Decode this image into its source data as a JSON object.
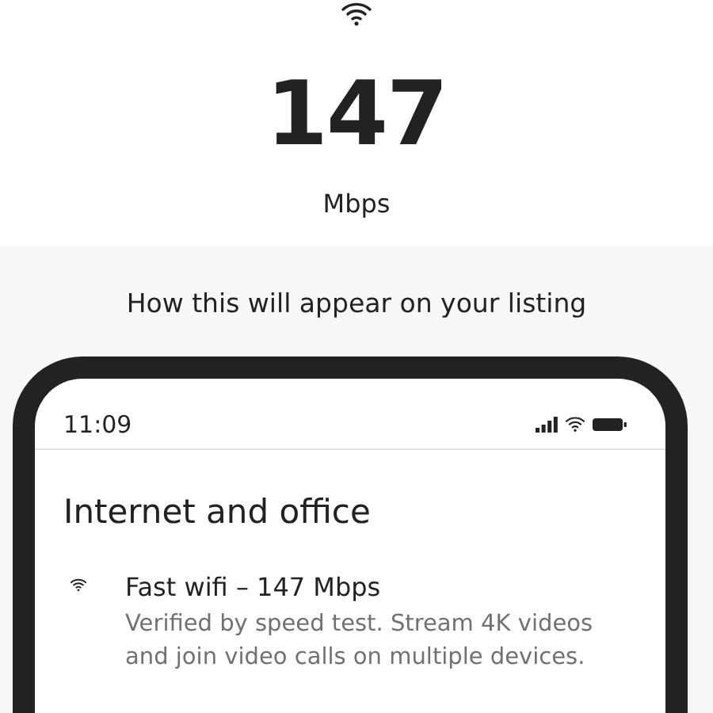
{
  "speed": {
    "value": "147",
    "unit": "Mbps"
  },
  "preview": {
    "heading": "How this will appear on your listing",
    "phone": {
      "time": "11:09",
      "section_title": "Internet and office",
      "amenities": [
        {
          "title": "Fast wifi – 147 Mbps",
          "description": "Verified by speed test. Stream 4K videos and join video calls on multiple devices."
        }
      ]
    }
  }
}
